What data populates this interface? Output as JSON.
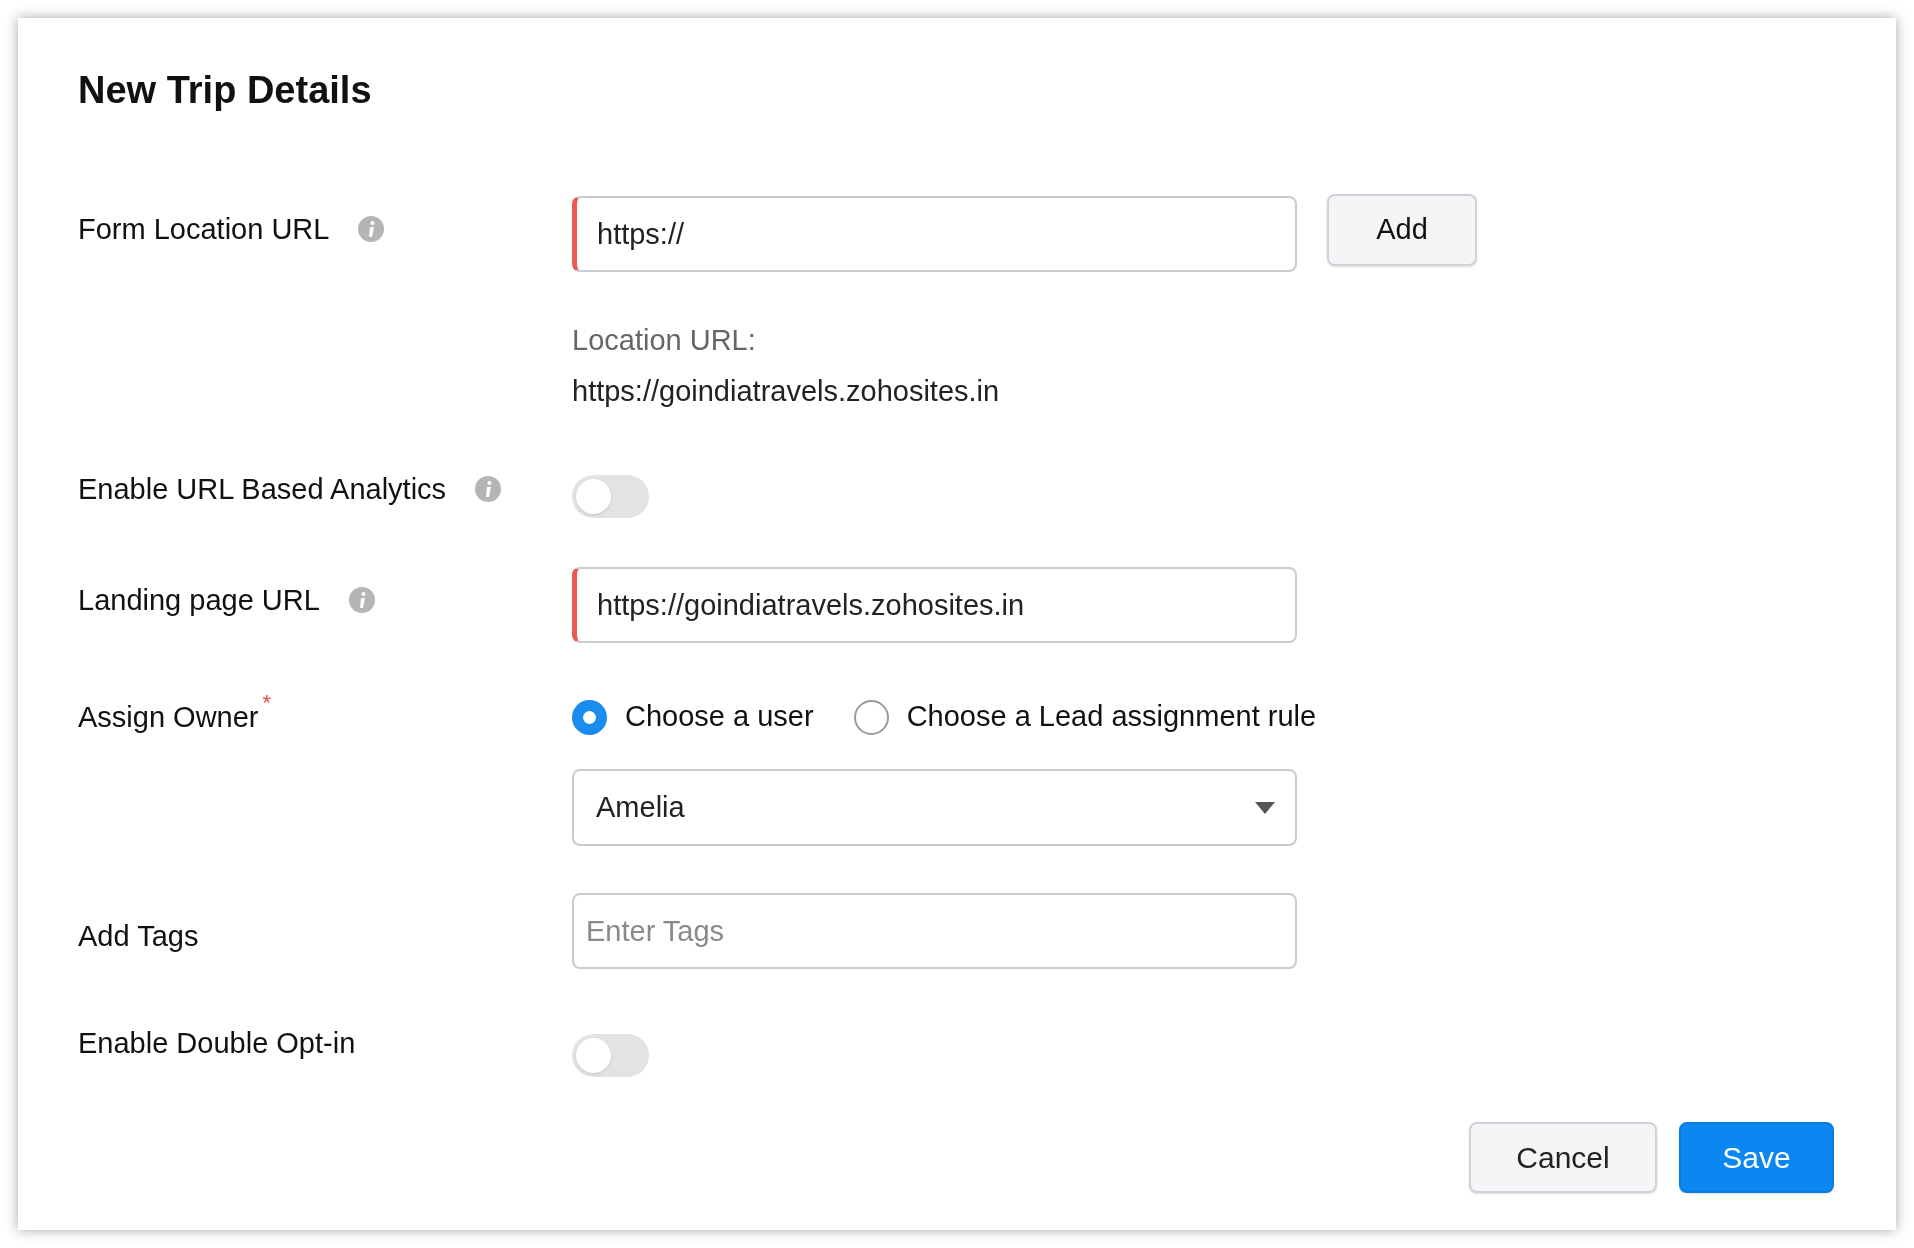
{
  "title": "New Trip Details",
  "fields": [
    {
      "kind": "url",
      "label": "Form Location URL",
      "info": true,
      "value": "https://",
      "flagged": true,
      "button": "Add",
      "note_label": "Location URL:",
      "note_value": "https://goindiatravels.zohosites.in"
    },
    {
      "kind": "toggle",
      "label": "Enable URL Based Analytics",
      "info": true,
      "on": false
    },
    {
      "kind": "url",
      "label": "Landing page URL",
      "info": true,
      "value": "https://goindiatravels.zohosites.in",
      "flagged": true
    },
    {
      "kind": "owner",
      "label": "Assign Owner",
      "required_mark": "*",
      "options": [
        {
          "label": "Choose a user",
          "selected": true
        },
        {
          "label": "Choose a Lead assignment rule",
          "selected": false
        }
      ],
      "value": "Amelia"
    },
    {
      "kind": "tags",
      "label": "Add Tags",
      "placeholder": "Enter Tags"
    },
    {
      "kind": "toggle",
      "label": "Enable Double Opt-in",
      "on": false
    }
  ],
  "buttons": [
    {
      "kind": "secondary",
      "label": "Cancel"
    },
    {
      "kind": "primary",
      "label": "Save"
    }
  ]
}
